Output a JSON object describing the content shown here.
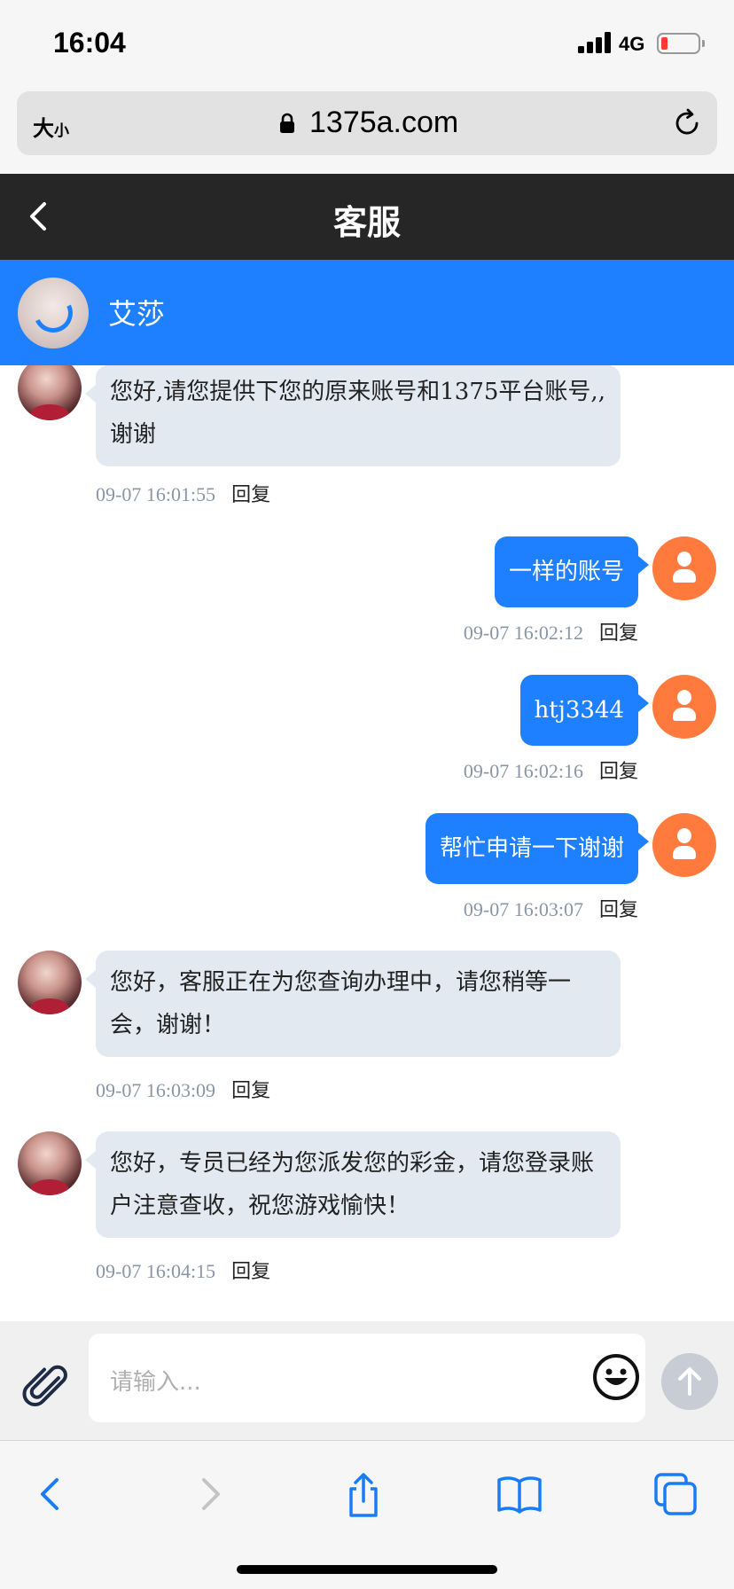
{
  "status_bar": {
    "time": "16:04",
    "network": "4G"
  },
  "browser": {
    "text_size_label": "大",
    "text_size_small": "小",
    "domain": "1375a.com"
  },
  "header": {
    "title": "客服"
  },
  "agent": {
    "name": "艾莎"
  },
  "messages": [
    {
      "side": "left",
      "text": "您好,请您提供下您的原来账号和1375平台账号,,谢谢",
      "time": "09-07 16:01:55",
      "reply": "回复"
    },
    {
      "side": "right",
      "text": "一样的账号",
      "time": "09-07 16:02:12",
      "reply": "回复"
    },
    {
      "side": "right",
      "text": "htj3344",
      "time": "09-07 16:02:16",
      "reply": "回复"
    },
    {
      "side": "right",
      "text": "帮忙申请一下谢谢",
      "time": "09-07 16:03:07",
      "reply": "回复"
    },
    {
      "side": "left",
      "text": "您好，客服正在为您查询办理中，请您稍等一会，谢谢！",
      "time": "09-07 16:03:09",
      "reply": "回复"
    },
    {
      "side": "left",
      "text": "您好，专员已经为您派发您的彩金，请您登录账户注意查收，祝您游戏愉快！",
      "time": "09-07 16:04:15",
      "reply": "回复"
    }
  ],
  "composer": {
    "placeholder": "请输入..."
  },
  "icons": {
    "attach": "paperclip-icon",
    "emoji": "smiley-icon",
    "send": "arrow-up-icon",
    "toolbar": [
      "back-arrow-icon",
      "forward-arrow-icon",
      "share-icon",
      "bookmarks-icon",
      "tabs-icon"
    ]
  },
  "colors": {
    "accent": "#1e80ff",
    "header_bg": "#262626",
    "user_avatar": "#ff7a3c",
    "agent_bubble": "#e3e9f1"
  }
}
